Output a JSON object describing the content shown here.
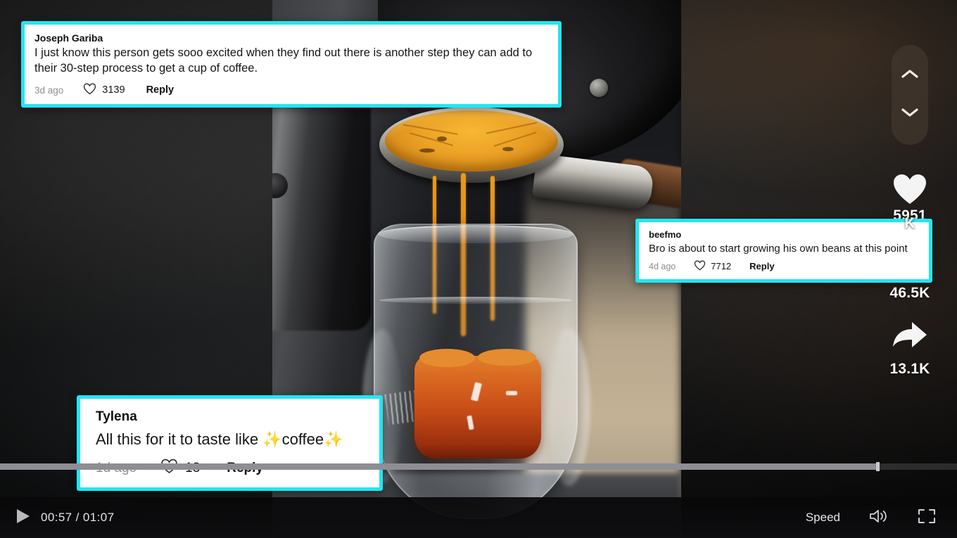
{
  "theme": {
    "cyan": "#1fe7f2",
    "white": "#ffffff",
    "text_dark": "#16161a",
    "muted": "#8d8d93"
  },
  "video": {
    "description": "espresso machine bottomless portafilter pouring a shot into a clear glass of water"
  },
  "comments": [
    {
      "id": "comment-1",
      "username": "Joseph Gariba",
      "text": "I just know this person gets sooo excited when they find out there is another step they can add to their 30-step process to get a cup of coffee.",
      "ago": "3d ago",
      "likes": "3139",
      "reply": "Reply",
      "heart_icon": "heart-outline-icon"
    },
    {
      "id": "comment-2",
      "username": "beefmo",
      "text": "Bro is about to start growing his own beans at this point",
      "ago": "4d ago",
      "likes": "7712",
      "reply": "Reply",
      "heart_icon": "heart-outline-icon"
    },
    {
      "id": "comment-3",
      "username": "Tylena",
      "text_before": "All this for it to taste like ",
      "sparkle_left": "✨",
      "text_middle": "coffee",
      "sparkle_right": "✨",
      "ago": "1d ago",
      "likes": "13",
      "reply": "Reply",
      "heart_icon": "heart-outline-icon"
    }
  ],
  "rail": {
    "nav": {
      "up_icon": "chevron-up-icon",
      "down_icon": "chevron-down-icon"
    },
    "actions": [
      {
        "name": "like",
        "icon": "heart-filled-icon",
        "count": "K"
      },
      {
        "name": "comment",
        "icon": "comment-icon",
        "count": "5951"
      },
      {
        "name": "bookmark",
        "icon": "bookmark-icon",
        "count": "46.5K"
      },
      {
        "name": "share",
        "icon": "share-arrow-icon",
        "count": "13.1K"
      }
    ]
  },
  "player": {
    "play_icon": "play-icon",
    "time": "00:57 / 01:07",
    "speed_label": "Speed",
    "volume_icon": "volume-icon",
    "fullscreen_icon": "fullscreen-icon",
    "progress_percent": 91.7
  }
}
